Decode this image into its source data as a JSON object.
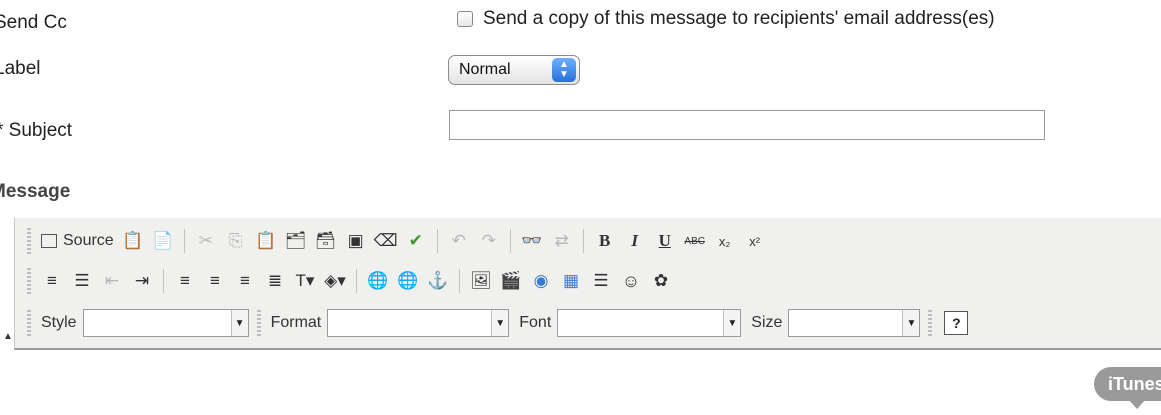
{
  "fields": {
    "send_cc_label": "Send Cc",
    "send_cc_checkbox_text": "Send a copy of this message to recipients' email address(es)",
    "label_label": "Label",
    "label_select_value": "Normal",
    "subject_label": "* Subject",
    "subject_value": "",
    "message_label": "Message"
  },
  "toolbar": {
    "source_label": "Source",
    "bold_glyph": "B",
    "italic_glyph": "I",
    "underline_glyph": "U",
    "strike_glyph": "ABC",
    "subscript_glyph": "x₂",
    "superscript_glyph": "x²",
    "help_glyph": "?",
    "style_label": "Style",
    "format_label": "Format",
    "font_label": "Font",
    "size_label": "Size",
    "style_value": "",
    "format_value": "",
    "font_value": "",
    "size_value": ""
  },
  "overlay": {
    "itunes_badge": "iTunes"
  },
  "icons": [
    "source-icon",
    "paste-icon",
    "templates-icon",
    "cut-icon",
    "copy-icon",
    "paste-text-icon",
    "paste-word-icon",
    "paste-html-icon",
    "select-all-icon",
    "remove-format-icon",
    "spellcheck-icon",
    "undo-icon",
    "redo-icon",
    "find-icon",
    "replace-icon",
    "ordered-list-icon",
    "unordered-list-icon",
    "outdent-icon",
    "indent-icon",
    "align-left-icon",
    "align-center-icon",
    "align-right-icon",
    "justify-icon",
    "text-color-icon",
    "background-color-icon",
    "link-icon",
    "unlink-icon",
    "anchor-icon",
    "image-icon",
    "flash-icon",
    "insert-object-icon",
    "table-icon",
    "horizontal-rule-icon",
    "smiley-icon",
    "special-char-icon",
    "help-icon"
  ],
  "colors": {
    "toolbar_bg": "#f0f0ee",
    "select_arrow": "#2770d8",
    "badge": "#9a9a9a"
  }
}
